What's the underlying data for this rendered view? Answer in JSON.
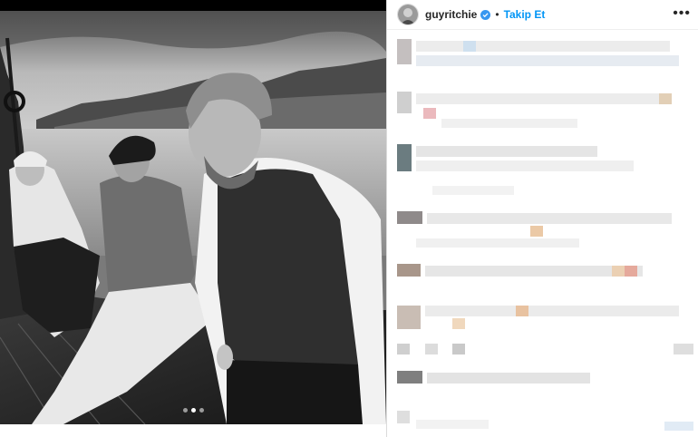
{
  "header": {
    "username": "guyritchie",
    "separator": "•",
    "follow_label": "Takip Et",
    "more_icon": "more-horizontal-icon",
    "verified_icon": "verified-badge-icon"
  },
  "carousel": {
    "slide_count": 3,
    "active_index": 1
  },
  "colors": {
    "accent": "#0095f6",
    "text": "#262626",
    "border": "#dbdbdb"
  }
}
